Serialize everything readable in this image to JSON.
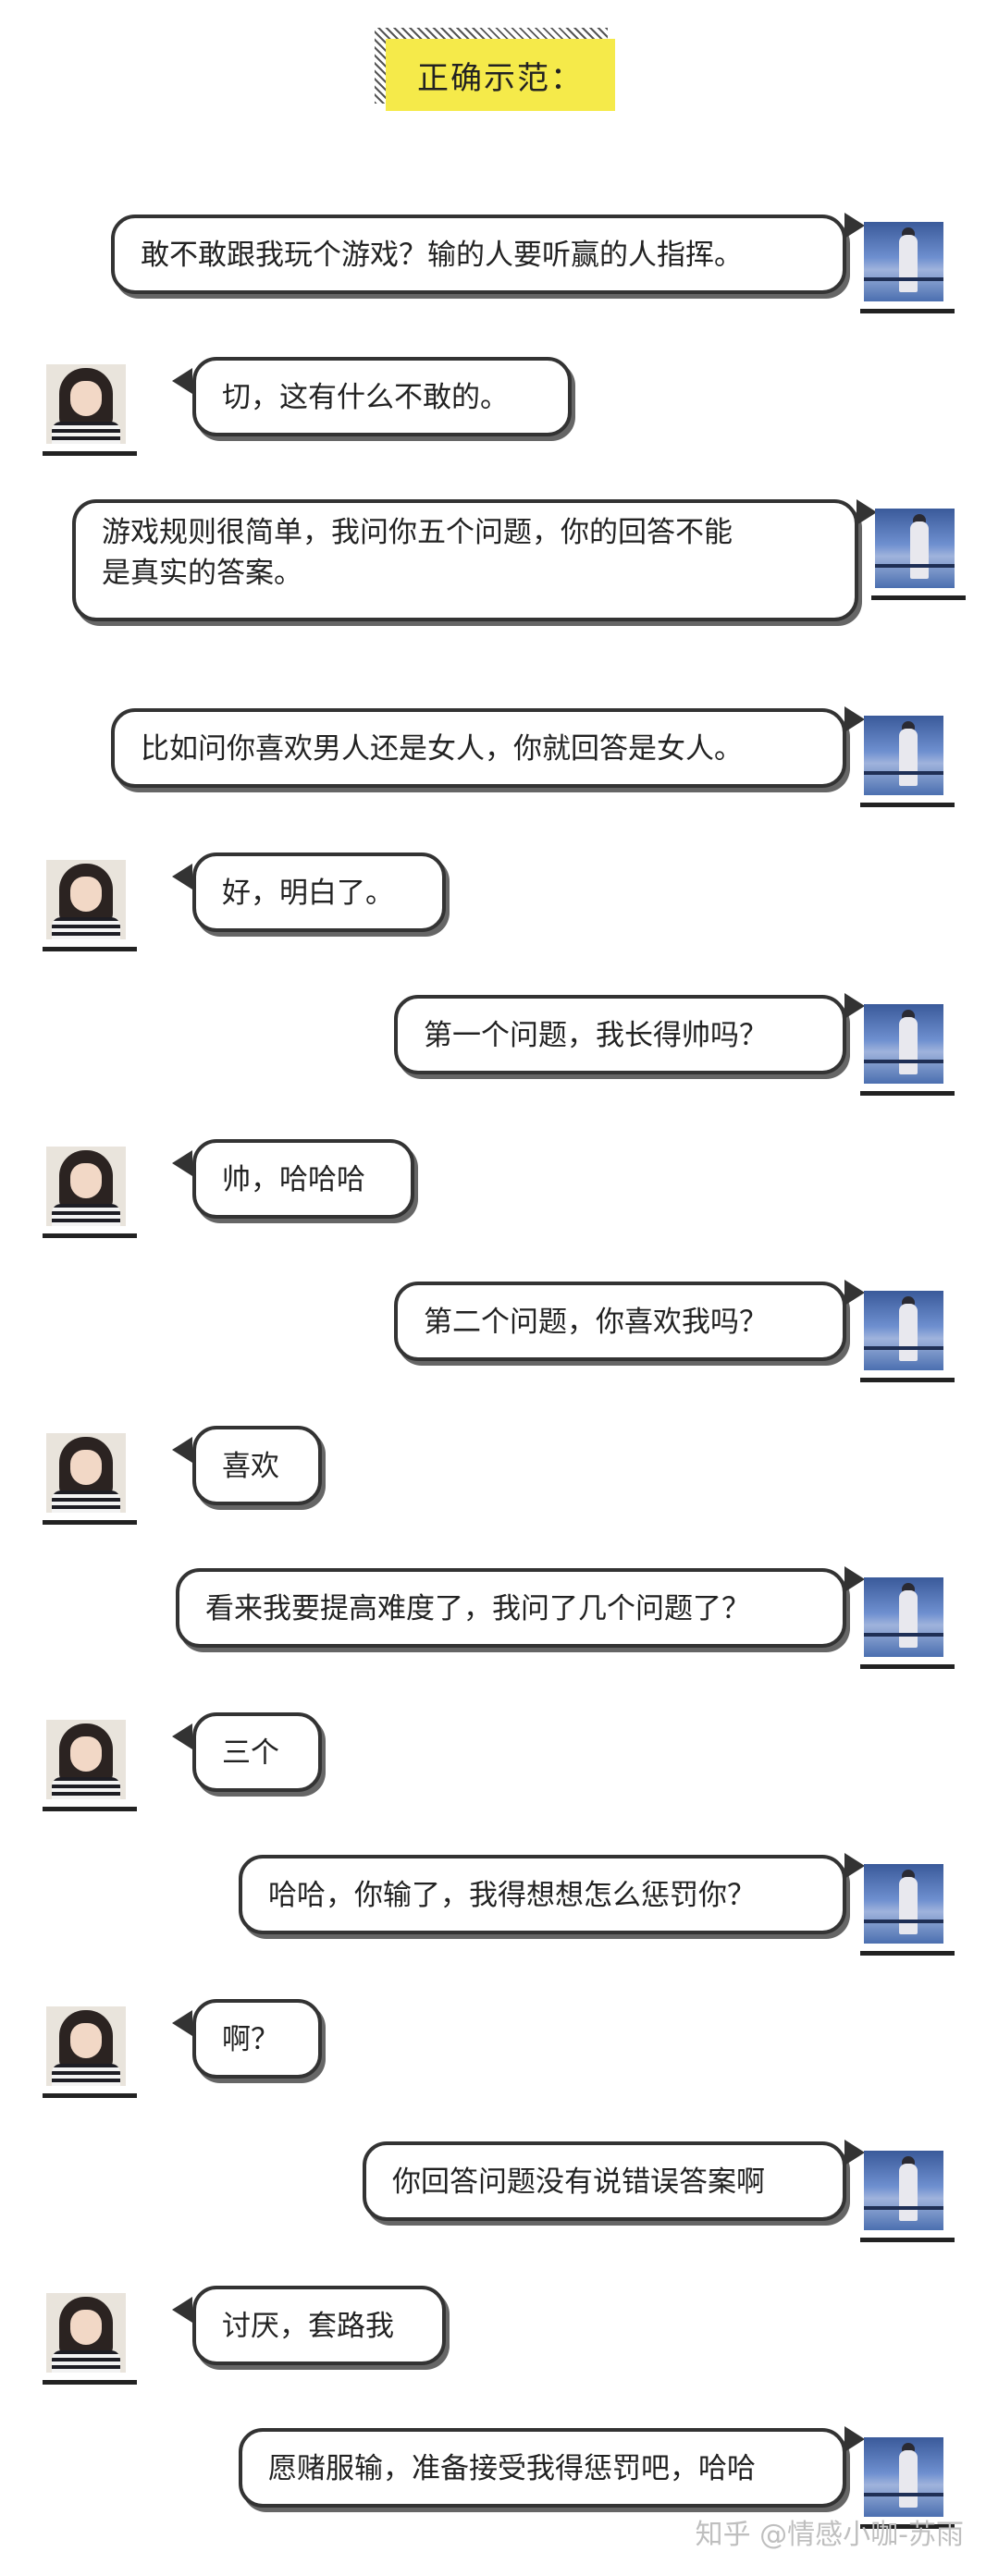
{
  "title": "正确示范：",
  "watermark": "知乎 @情感小咖-苏雨",
  "messages": [
    {
      "side": "right",
      "text": "敢不敢跟我玩个游戏？输的人要听赢的人指挥。"
    },
    {
      "side": "left",
      "text": "切，这有什么不敢的。"
    },
    {
      "side": "right",
      "text": "游戏规则很简单，我问你五个问题，你的回答不能\n是真实的答案。"
    },
    {
      "side": "right",
      "text": "比如问你喜欢男人还是女人，你就回答是女人。"
    },
    {
      "side": "left",
      "text": "好，明白了。"
    },
    {
      "side": "right",
      "text": "第一个问题，我长得帅吗？"
    },
    {
      "side": "left",
      "text": "帅，哈哈哈"
    },
    {
      "side": "right",
      "text": "第二个问题，你喜欢我吗？"
    },
    {
      "side": "left",
      "text": "喜欢"
    },
    {
      "side": "right",
      "text": "看来我要提高难度了，我问了几个问题了？"
    },
    {
      "side": "left",
      "text": "三个"
    },
    {
      "side": "right",
      "text": "哈哈，你输了，我得想想怎么惩罚你？"
    },
    {
      "side": "left",
      "text": "啊？"
    },
    {
      "side": "right",
      "text": "你回答问题没有说错误答案啊"
    },
    {
      "side": "left",
      "text": "讨厌，套路我"
    },
    {
      "side": "right",
      "text": "愿赌服输，准备接受我得惩罚吧，哈哈"
    }
  ]
}
